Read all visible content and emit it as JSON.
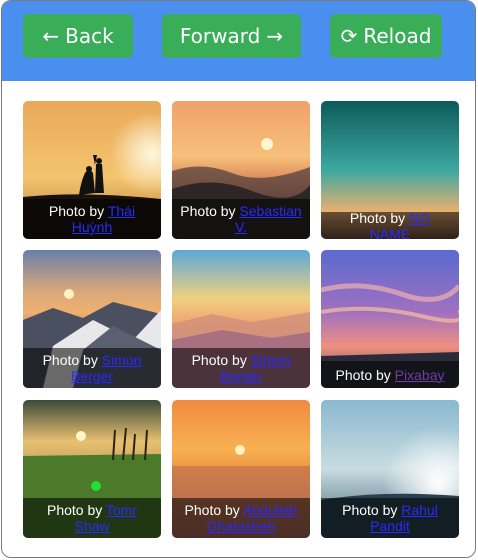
{
  "toolbar": {
    "back": {
      "glyph": "←",
      "label": "Back"
    },
    "forward": {
      "glyph": "→",
      "label": "Forward"
    },
    "reload": {
      "glyph": "⟳",
      "label": "Reload"
    },
    "color": "#4a8ff0",
    "button_color": "#3aad58"
  },
  "photos": [
    {
      "prefix": "Photo by ",
      "author": "Thái Huỳnh"
    },
    {
      "prefix": "Photo by ",
      "author": "Sebastian V."
    },
    {
      "prefix": "Photo by ",
      "author": "NO NAME"
    },
    {
      "prefix": "Photo by ",
      "author": "Simon Berger"
    },
    {
      "prefix": "Photo by ",
      "author": "Simon Berger"
    },
    {
      "prefix": "Photo by ",
      "author": "Pixabay"
    },
    {
      "prefix": "Photo by ",
      "author": "Tomr Shaw"
    },
    {
      "prefix": "Photo by ",
      "author": "Abdullah Ghatasheh"
    },
    {
      "prefix": "Photo by ",
      "author": "Rahul Pandit"
    }
  ]
}
